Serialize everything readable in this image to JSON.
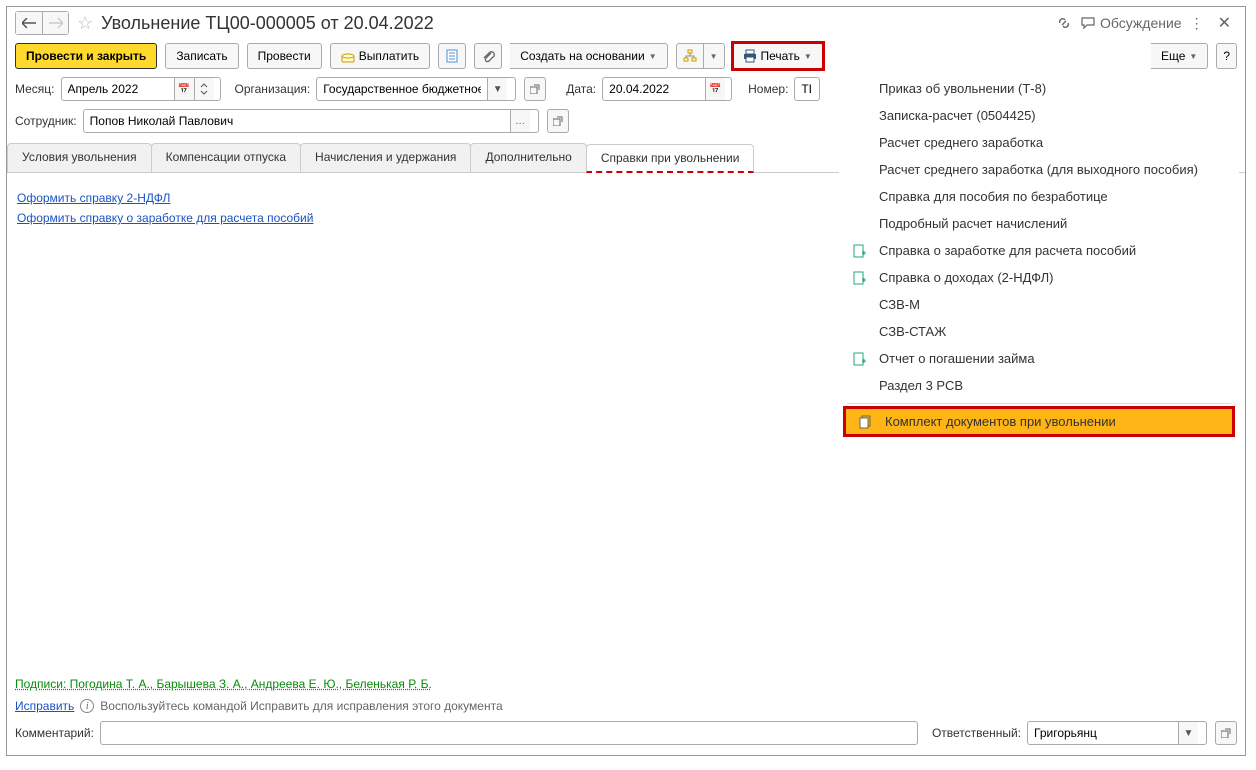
{
  "title": "Увольнение ТЦ00-000005 от 20.04.2022",
  "discussion": "Обсуждение",
  "toolbar": {
    "primary": "Провести и закрыть",
    "write": "Записать",
    "post": "Провести",
    "pay": "Выплатить",
    "create_based": "Создать на основании",
    "print": "Печать",
    "more": "Еще"
  },
  "labels": {
    "month": "Месяц:",
    "org": "Организация:",
    "date": "Дата:",
    "number": "Номер:",
    "employee": "Сотрудник:",
    "comment": "Комментарий:",
    "responsible": "Ответственный:"
  },
  "values": {
    "month": "Апрель 2022",
    "org": "Государственное бюджетное",
    "date": "20.04.2022",
    "number": "ТЦ",
    "employee": "Попов Николай Павлович",
    "comment": "",
    "responsible": "Григорьянц"
  },
  "tabs": {
    "t1": "Условия увольнения",
    "t2": "Компенсации отпуска",
    "t3": "Начисления и удержания",
    "t4": "Дополнительно",
    "t5": "Справки при увольнении"
  },
  "links": {
    "l1": "Оформить справку 2-НДФЛ",
    "l2": "Оформить справку о заработке для расчета пособий"
  },
  "footer": {
    "signatures": "Подписи: Погодина Т. А., Барышева З. А., Андреева Е. Ю., Беленькая Р. Б.",
    "fix": "Исправить",
    "fix_hint": "Воспользуйтесь командой Исправить для исправления этого документа"
  },
  "print_menu": {
    "m1": "Приказ об увольнении (Т-8)",
    "m2": "Записка-расчет (0504425)",
    "m3": "Расчет среднего заработка",
    "m4": "Расчет среднего заработка (для выходного пособия)",
    "m5": "Справка для пособия по безработице",
    "m6": "Подробный расчет начислений",
    "m7": "Справка о заработке для расчета пособий",
    "m8": "Справка о доходах (2-НДФЛ)",
    "m9": "СЗВ-М",
    "m10": "СЗВ-СТАЖ",
    "m11": "Отчет о погашении займа",
    "m12": "Раздел 3 РСВ",
    "m13": "Комплект документов при увольнении"
  }
}
